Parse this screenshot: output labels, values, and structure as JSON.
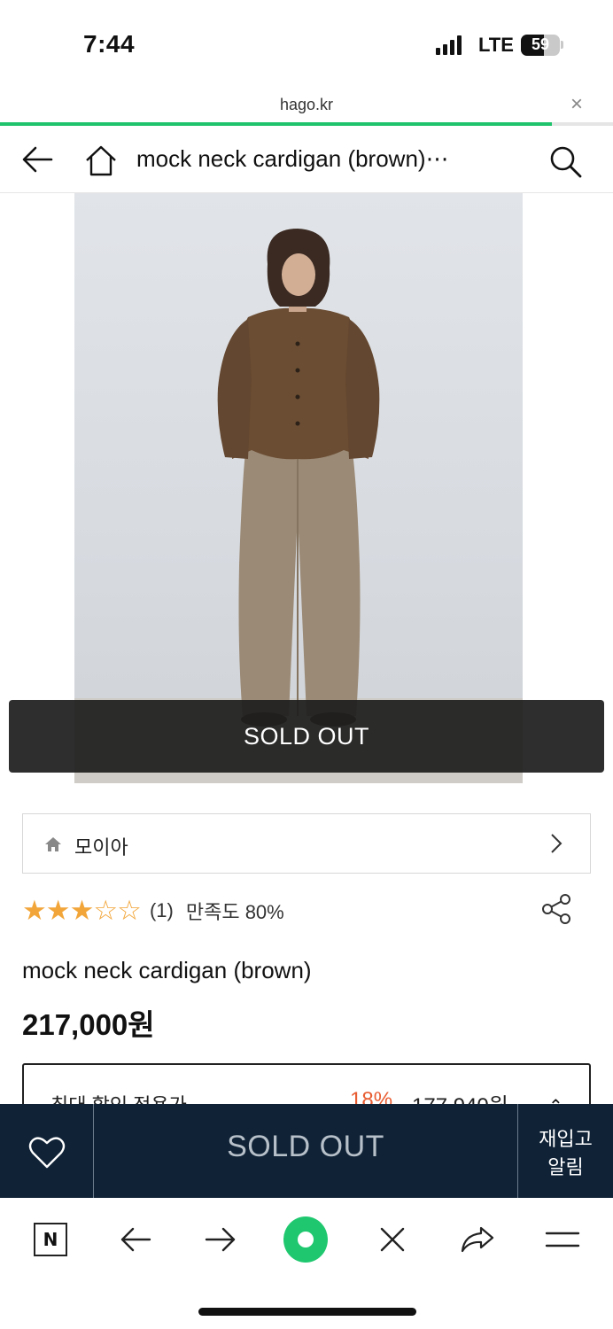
{
  "status_bar": {
    "time": "7:44",
    "network": "LTE",
    "battery": "59",
    "battery_level": 0.59
  },
  "browser": {
    "domain": "hago.kr",
    "close_label": "×",
    "load_progress": 0.9
  },
  "header": {
    "title": "mock neck cardigan (brown)⋯"
  },
  "product": {
    "overlay_label": "SOLD OUT",
    "store_name": "모이아",
    "rating": {
      "stars": "★★★☆☆",
      "count": "(1)",
      "satisfaction": "만족도 80%",
      "value": 3,
      "max": 5
    },
    "name": "mock neck cardigan (brown)",
    "price": "217,000원",
    "discount": {
      "label": "최대 할인 적용가",
      "percent": "18%",
      "price": "177,940원",
      "toggle": "⌃"
    }
  },
  "buy_bar": {
    "sold_out_label": "SOLD OUT",
    "restock_line1": "재입고",
    "restock_line2": "알림"
  },
  "toolbar": {
    "naver_label": "N"
  },
  "colors": {
    "accent_green": "#1ec36b",
    "buy_bar_bg": "#0f2236",
    "star": "#f2a63a",
    "discount_red": "#e85c31"
  }
}
